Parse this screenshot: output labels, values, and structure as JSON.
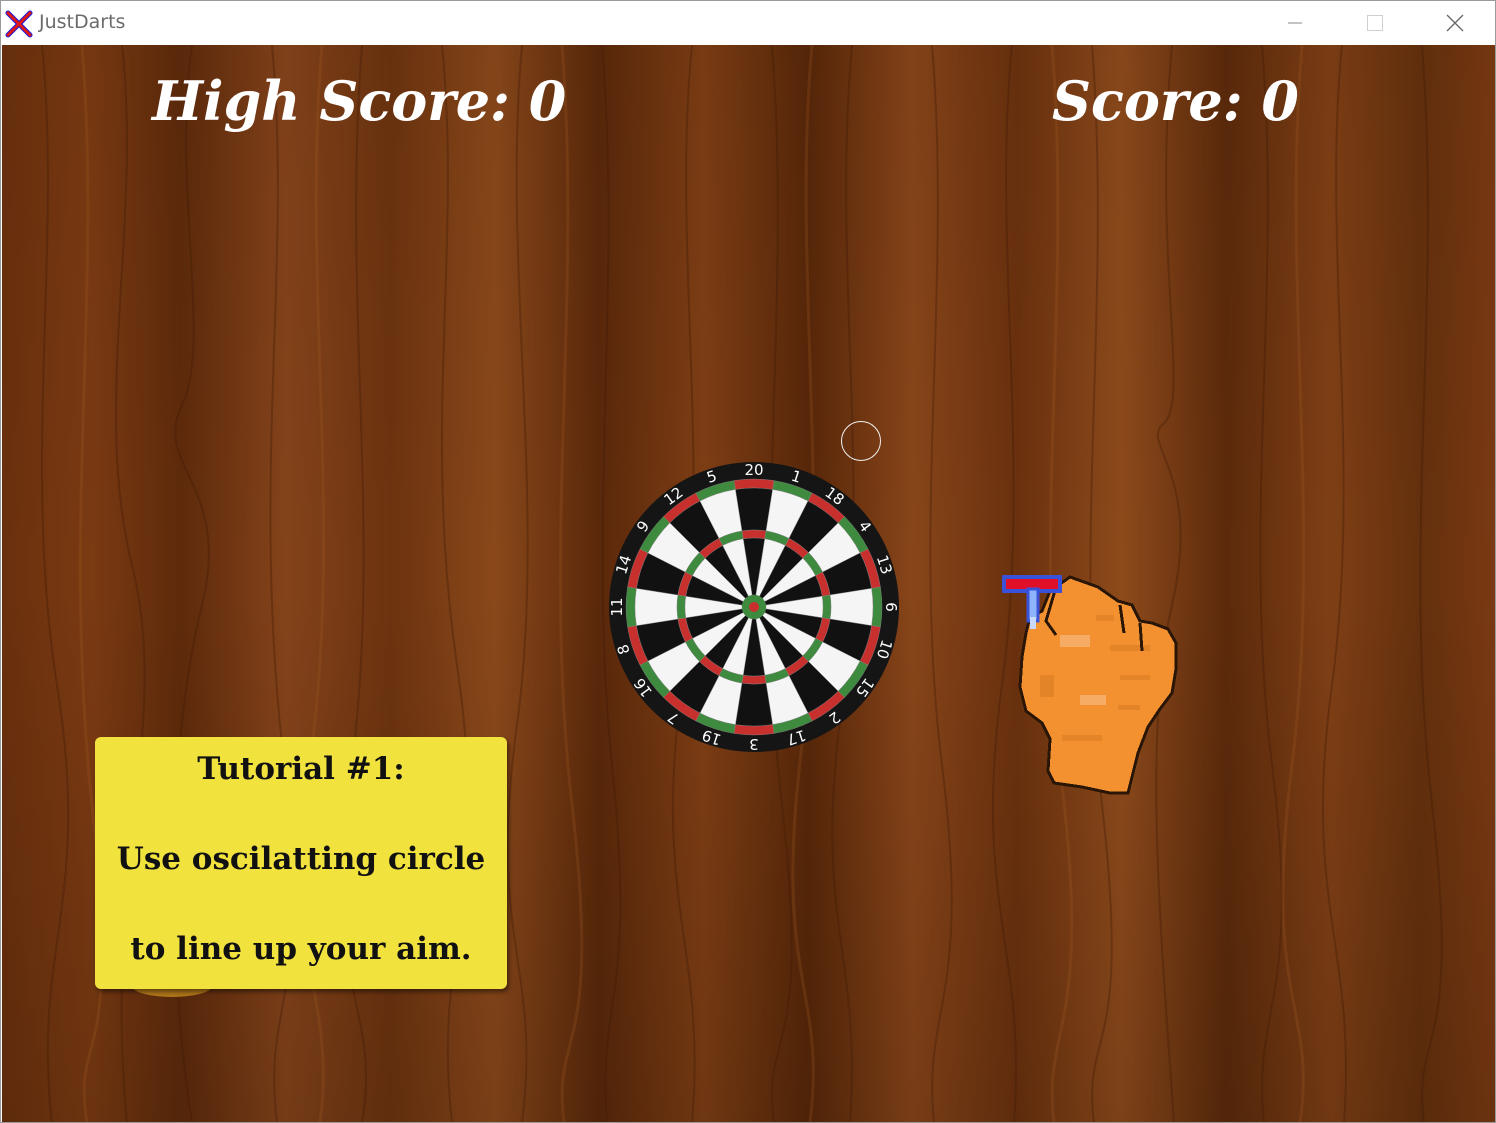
{
  "window": {
    "title": "JustDarts",
    "icon": "red-x-app-icon",
    "controls": {
      "minimize": "minimize-icon",
      "maximize": "maximize-icon",
      "close": "close-icon"
    }
  },
  "hud": {
    "high_score_label": "High Score: 0",
    "score_label": "Score: 0"
  },
  "dartboard": {
    "numbers": [
      "20",
      "1",
      "18",
      "4",
      "13",
      "6",
      "10",
      "15",
      "2",
      "17",
      "3",
      "19",
      "7",
      "16",
      "8",
      "11",
      "14",
      "9",
      "12",
      "5"
    ],
    "colors": {
      "red": "#c8302e",
      "green": "#3e8a3e",
      "black": "#111111",
      "white": "#f5f5f5"
    }
  },
  "tutorial": {
    "line1": "Tutorial #1:",
    "line2": "Use oscilatting circle",
    "line3": "to line up your aim."
  },
  "colors": {
    "wood_dark": "#5a2a0c",
    "wood_light": "#8c4a18",
    "hand": "#f39130",
    "tutorial_bg": "#f2e23e",
    "dart_red": "#e0102a",
    "dart_blue": "#3a52d8"
  }
}
